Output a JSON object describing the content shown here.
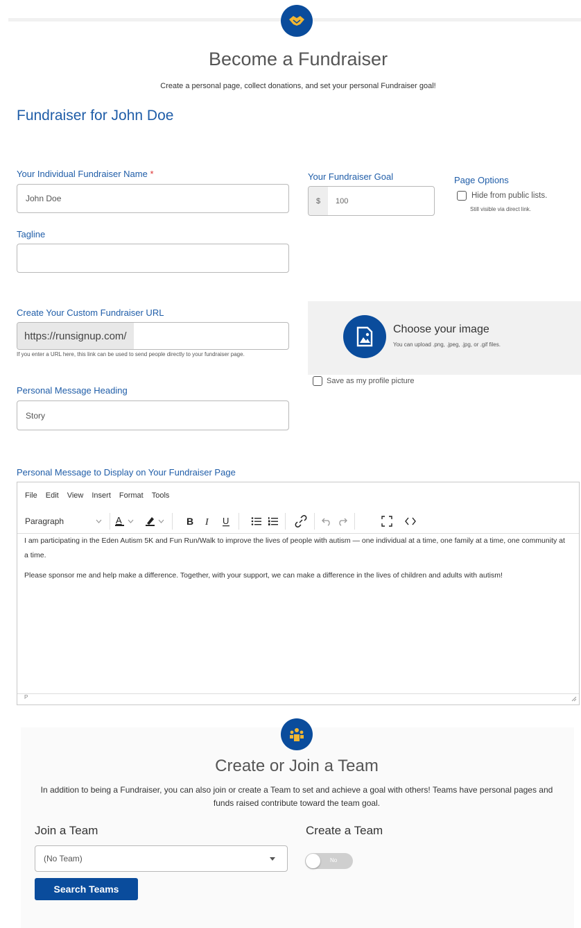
{
  "header": {
    "icon": "handshake-icon",
    "title": "Become a Fundraiser",
    "subtitle": "Create a personal page, collect donations, and set your personal Fundraiser goal!",
    "fundraiser_heading": "Fundraiser for John Doe"
  },
  "form": {
    "name_label": "Your Individual Fundraiser Name",
    "required_mark": "*",
    "name_value": "John Doe",
    "tagline_label": "Tagline",
    "tagline_value": "",
    "goal_label": "Your Fundraiser Goal",
    "goal_prefix": "$",
    "goal_value": "100",
    "page_options_label": "Page Options",
    "hide_label": "Hide from public lists.",
    "hide_sub": "Still visible via direct link.",
    "url_label": "Create Your Custom Fundraiser URL",
    "url_prefix": "https://runsignup.com/",
    "url_value": "",
    "url_help": "If you enter a URL here, this link can be used to send people directly to your fundraiser page.",
    "image_title": "Choose your image",
    "image_sub": "You can upload .png, .jpeg, .jpg, or .gif files.",
    "profile_pic_label": "Save as my profile picture",
    "message_heading_label": "Personal Message Heading",
    "message_heading_value": "Story",
    "message_label": "Personal Message to Display on Your Fundraiser Page"
  },
  "editor": {
    "menu": [
      "File",
      "Edit",
      "View",
      "Insert",
      "Format",
      "Tools"
    ],
    "block_format": "Paragraph",
    "paragraphs": [
      "I am participating in the Eden Autism 5K and Fun Run/Walk to improve the lives of people with autism — one individual at a time, one family at a time, one community at a time.",
      "Please sponsor me and help make a difference. Together, with your support, we can make a difference in the lives of children and adults with autism!"
    ],
    "status_path": "P"
  },
  "team": {
    "icon": "team-icon",
    "title": "Create or Join a Team",
    "description": "In addition to being a Fundraiser, you can also join or create a Team to set and achieve a goal with others! Teams have personal pages and funds raised contribute toward the team goal.",
    "join_label": "Join a Team",
    "create_label": "Create a Team",
    "select_value": "(No Team)",
    "toggle_label": "No",
    "search_button": "Search Teams"
  },
  "colors": {
    "primary": "#0a4c9c",
    "link": "#1f5da8",
    "icon_accent": "#f2b632"
  }
}
